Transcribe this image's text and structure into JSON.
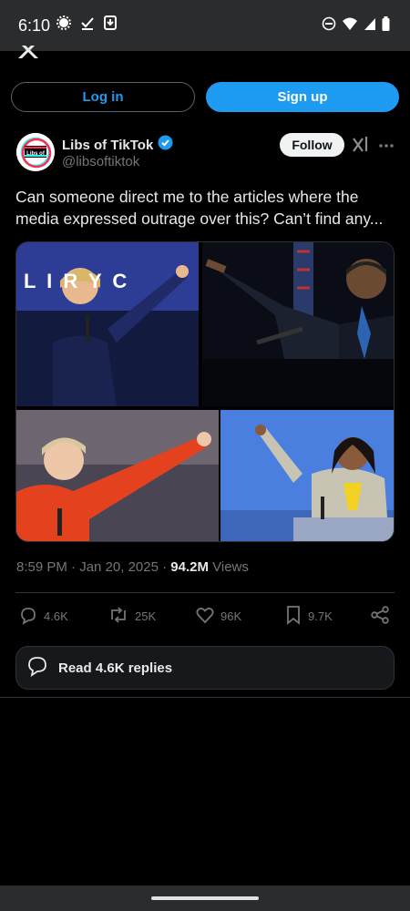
{
  "status_bar": {
    "time": "6:10",
    "left_icons": [
      "settings-gear-icon",
      "check-download-icon",
      "download-box-icon"
    ],
    "right_icons": [
      "do-not-disturb-icon",
      "wifi-icon",
      "signal-icon",
      "battery-icon"
    ]
  },
  "auth": {
    "login_label": "Log in",
    "signup_label": "Sign up"
  },
  "tweet": {
    "avatar_label": "Libs of TikTok",
    "display_name": "Libs of TikTok",
    "verified": true,
    "handle": "@libsoftiktok",
    "follow_label": "Follow",
    "text": "Can someone direct me to the articles where the media expressed outrage over this? Can’t find any...",
    "media_banner_text": "L I  R Y C",
    "timestamp": "8:59 PM · Jan 20, 2025 · ",
    "views_count": "94.2M",
    "views_label": " Views"
  },
  "actions": {
    "replies": "4.6K",
    "reposts": "25K",
    "likes": "96K",
    "bookmarks": "9.7K"
  },
  "read_replies_label": "Read 4.6K replies",
  "colors": {
    "accent": "#1d9bf0",
    "background": "#000000",
    "muted_text": "#71767b",
    "border": "#2f3336"
  }
}
